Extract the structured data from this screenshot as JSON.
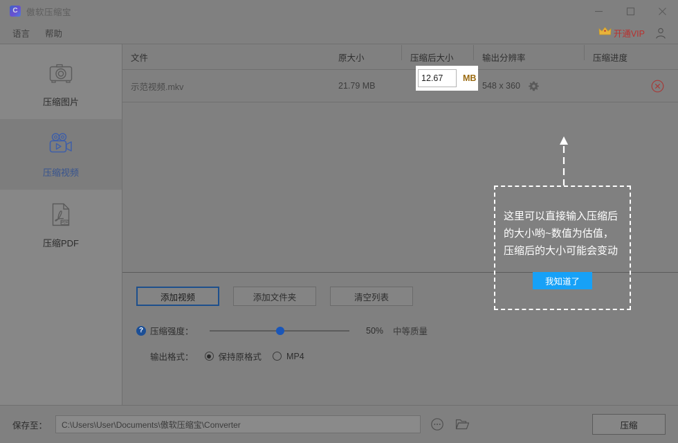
{
  "window": {
    "title": "傲软压缩宝",
    "icon": "app-logo-icon",
    "minimize": "–",
    "maximize": "□",
    "close": "✕"
  },
  "menu": {
    "items": [
      {
        "label": "语言"
      },
      {
        "label": "帮助"
      }
    ],
    "vip_label": "开通VIP",
    "vip_color": "#b8312f",
    "crown_color": "#e8b23a"
  },
  "sidebar": {
    "items": [
      {
        "label": "压缩图片",
        "icon": "camera-icon",
        "active": false
      },
      {
        "label": "压缩视频",
        "icon": "video-camera-icon",
        "active": true
      },
      {
        "label": "压缩PDF",
        "icon": "pdf-file-icon",
        "active": false
      }
    ],
    "active_color": "#36538f"
  },
  "table": {
    "headers": [
      {
        "label": "文件"
      },
      {
        "label": "原大小"
      },
      {
        "label": "压缩后大小"
      },
      {
        "label": "输出分辨率"
      },
      {
        "label": "压缩进度"
      }
    ],
    "rows": [
      {
        "file": "示范视频.mkv",
        "original_size": "21.79 MB",
        "target_size_value": "12.67",
        "target_size_unit": "MB",
        "resolution": "548 x 360",
        "progress": ""
      }
    ]
  },
  "coachmark": {
    "text": "这里可以直接输入压缩后的大小哟~数值为估值，压缩后的大小可能会变动",
    "button_label": "我知道了",
    "button_color": "#17a1f7"
  },
  "options": {
    "buttons": [
      {
        "label": "添加视频",
        "primary": true
      },
      {
        "label": "添加文件夹",
        "primary": false
      },
      {
        "label": "清空列表",
        "primary": false
      }
    ],
    "strength": {
      "help": "?",
      "label": "压缩强度：",
      "percent": "50%",
      "quality": "中等质量",
      "value": 50
    },
    "format": {
      "label": "输出格式：",
      "options": [
        {
          "label": "保持原格式",
          "selected": true
        },
        {
          "label": "MP4",
          "selected": false
        }
      ]
    }
  },
  "bottom": {
    "save_label": "保存至：",
    "path": "C:\\Users\\User\\Documents\\傲软压缩宝\\Converter",
    "more_icon": "ellipsis-circle-icon",
    "folder_icon": "open-folder-icon",
    "compress_label": "压缩"
  }
}
